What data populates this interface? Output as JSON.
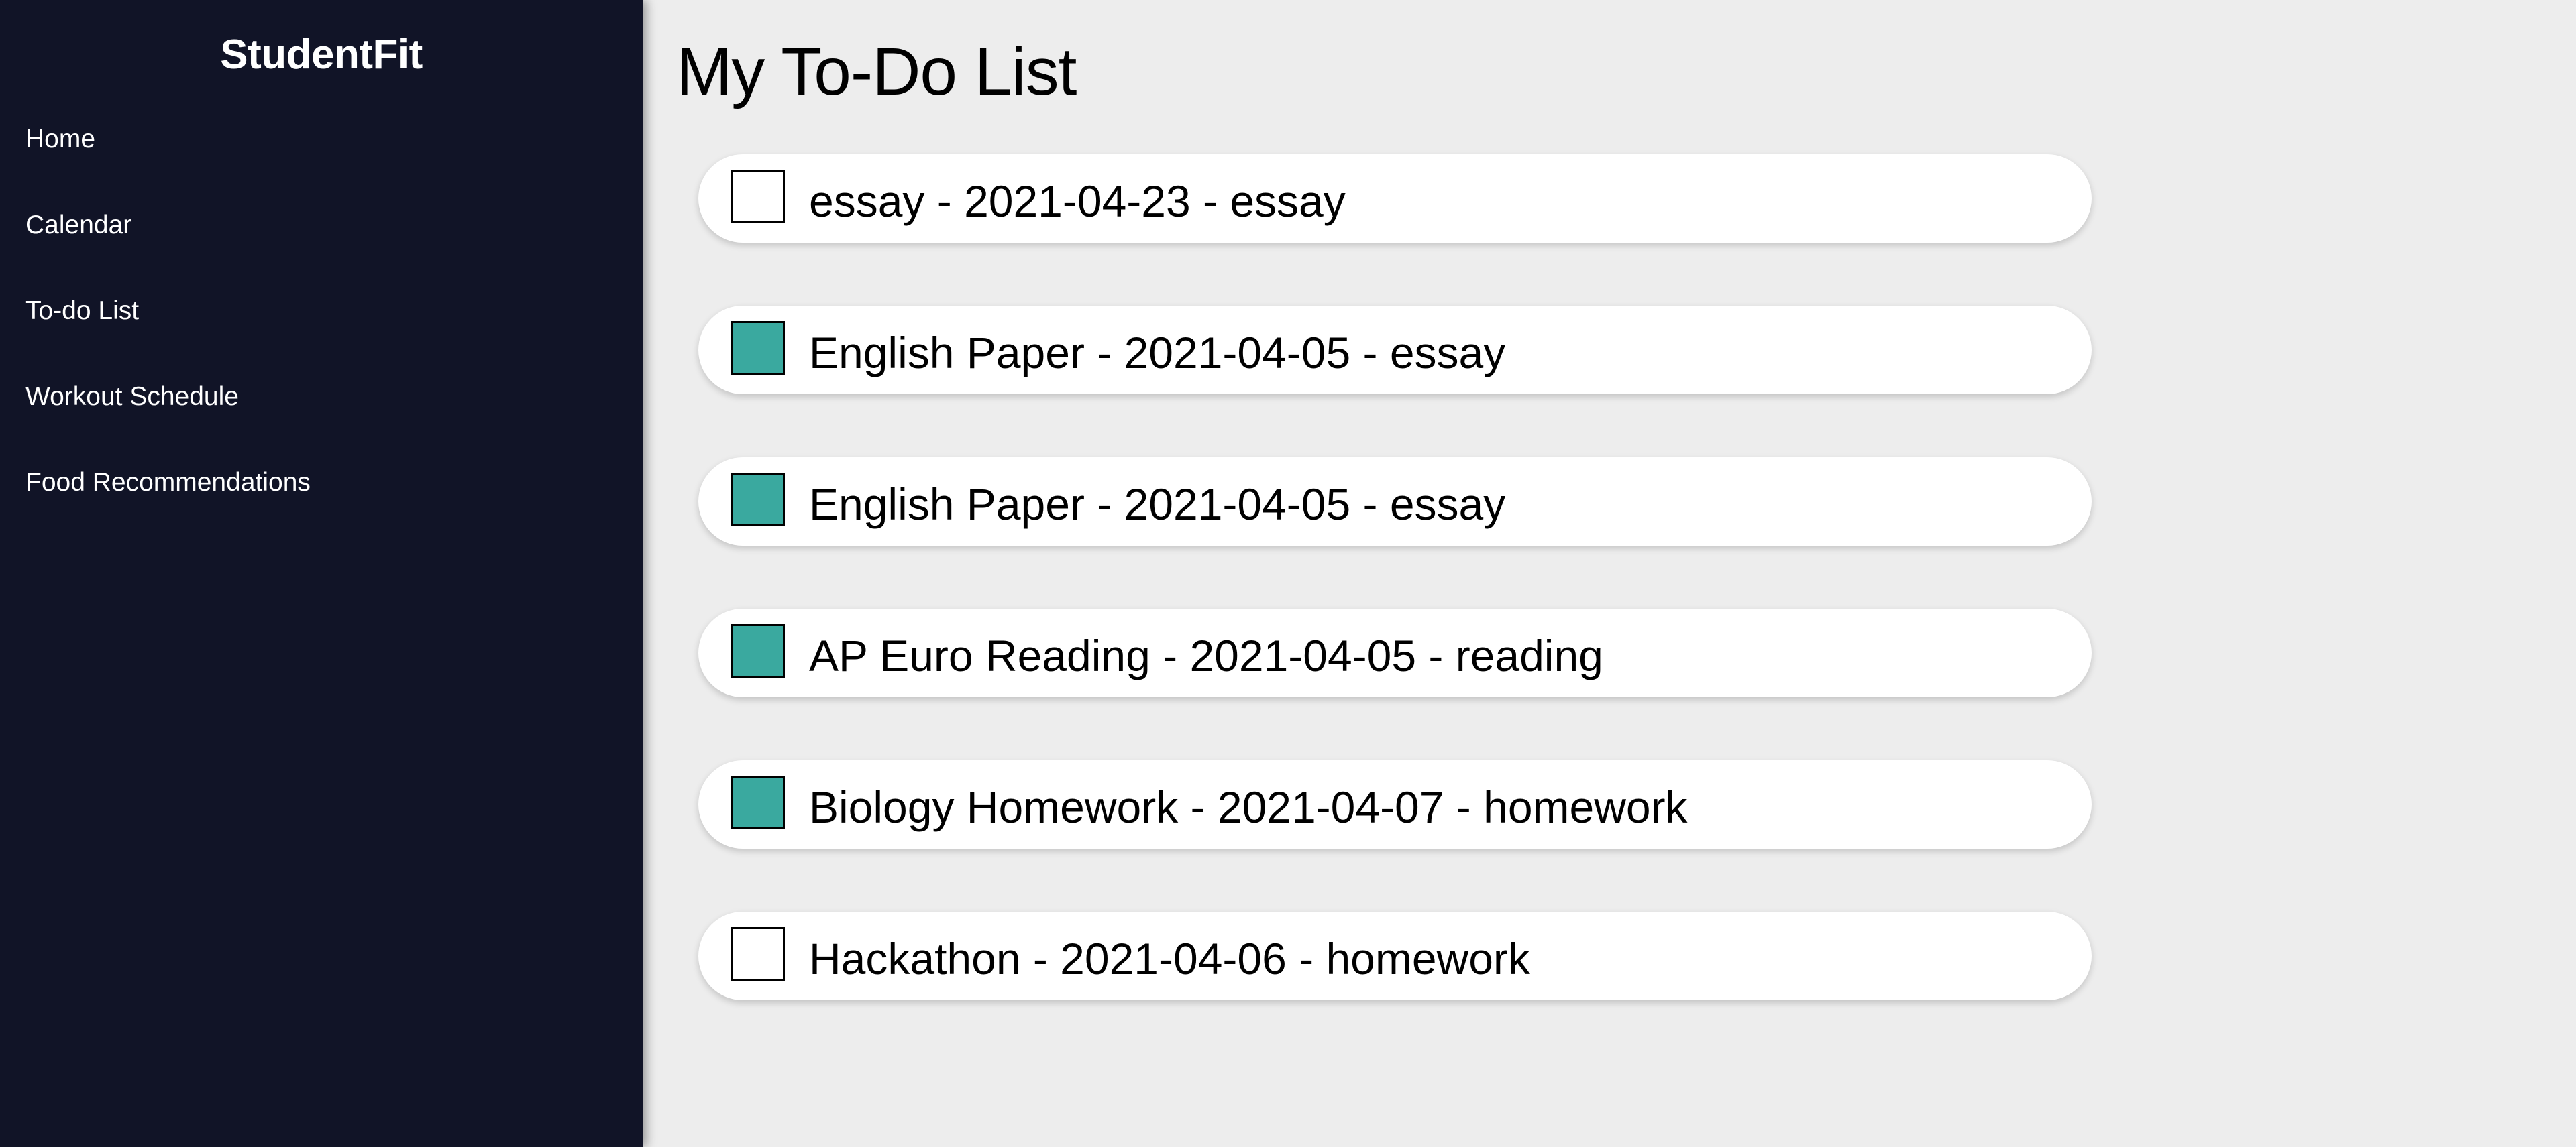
{
  "app": {
    "brand": "StudentFit"
  },
  "sidebar": {
    "items": [
      {
        "label": "Home"
      },
      {
        "label": "Calendar"
      },
      {
        "label": "To-do List"
      },
      {
        "label": "Workout Schedule"
      },
      {
        "label": "Food Recommendations"
      }
    ]
  },
  "main": {
    "title": "My To-Do List",
    "todos": [
      {
        "text": "essay - 2021-04-23 - essay",
        "checked": false
      },
      {
        "text": "English Paper - 2021-04-05 - essay",
        "checked": true
      },
      {
        "text": "English Paper - 2021-04-05 - essay",
        "checked": true
      },
      {
        "text": "AP Euro Reading - 2021-04-05 - reading",
        "checked": true
      },
      {
        "text": "Biology Homework - 2021-04-07 - homework",
        "checked": true
      },
      {
        "text": "Hackathon - 2021-04-06 - homework",
        "checked": false
      }
    ]
  },
  "colors": {
    "sidebar_bg": "#111427",
    "page_bg": "#ededed",
    "checked_fill": "#3aa99f"
  }
}
